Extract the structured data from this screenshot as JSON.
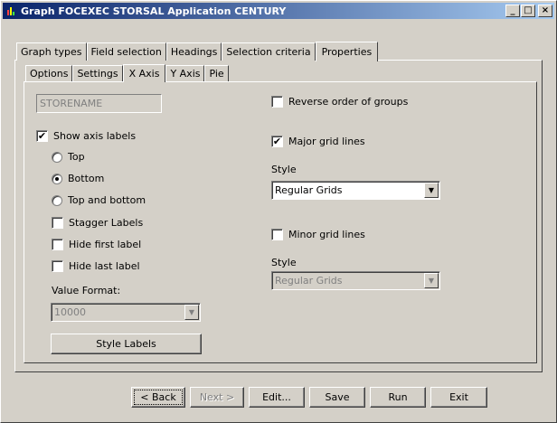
{
  "window": {
    "title": "Graph FOCEXEC STORSAL Application CENTURY",
    "controls": {
      "minimize": "_",
      "maximize": "□",
      "close": "×"
    },
    "icon": "bar-chart-icon"
  },
  "outer_tabs": [
    {
      "label": "Graph types",
      "active": false
    },
    {
      "label": "Field selection",
      "active": false
    },
    {
      "label": "Headings",
      "active": false
    },
    {
      "label": "Selection criteria",
      "active": false
    },
    {
      "label": "Properties",
      "active": true
    }
  ],
  "inner_tabs": [
    {
      "label": "Options",
      "active": false
    },
    {
      "label": "Settings",
      "active": false
    },
    {
      "label": "X Axis",
      "active": true
    },
    {
      "label": "Y Axis",
      "active": false
    },
    {
      "label": "Pie",
      "active": false
    }
  ],
  "xaxis": {
    "field_value": "STORENAME",
    "show_axis_labels": {
      "label": "Show axis labels",
      "checked": true
    },
    "position": {
      "top": {
        "label": "Top",
        "selected": false
      },
      "bottom": {
        "label": "Bottom",
        "selected": true
      },
      "top_and_bottom": {
        "label": "Top and bottom",
        "selected": false
      }
    },
    "stagger_labels": {
      "label": "Stagger Labels",
      "checked": false
    },
    "hide_first_label": {
      "label": "Hide first label",
      "checked": false
    },
    "hide_last_label": {
      "label": "Hide last label",
      "checked": false
    },
    "value_format_label": "Value Format:",
    "value_format": "10000",
    "style_labels_button": "Style Labels",
    "reverse_order": {
      "label": "Reverse order of groups",
      "checked": false
    },
    "major_grid": {
      "label": "Major grid lines",
      "checked": true
    },
    "major_style_label": "Style",
    "major_style_value": "Regular Grids",
    "minor_grid": {
      "label": "Minor grid lines",
      "checked": false
    },
    "minor_style_label": "Style",
    "minor_style_value": "Regular Grids"
  },
  "buttons": {
    "back": "< Back",
    "next": "Next >",
    "edit": "Edit...",
    "save": "Save",
    "run": "Run",
    "exit": "Exit"
  },
  "glyphs": {
    "check": "✔",
    "dropdown": "▼"
  }
}
